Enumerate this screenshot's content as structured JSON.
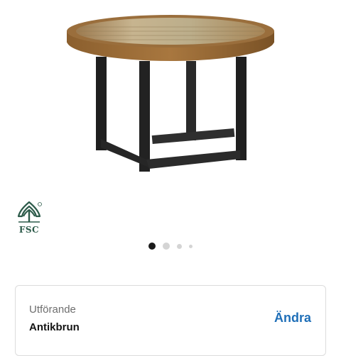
{
  "product": {
    "image_icon": "round-coffee-table-photo",
    "badge": {
      "icon": "fsc-tree-icon",
      "text": "FSC",
      "color": "#2d5b4a"
    }
  },
  "pager": {
    "count": 4,
    "active_index": 0
  },
  "variant": {
    "label": "Utförande",
    "value": "Antikbrun",
    "change_label": "Ändra",
    "accent_color": "#1f6fb8"
  }
}
